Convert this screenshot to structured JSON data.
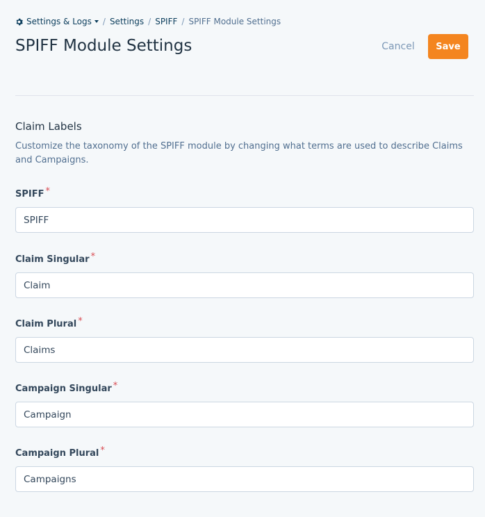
{
  "breadcrumb": {
    "root_label": "Settings & Logs",
    "separator": "/",
    "items": [
      "Settings",
      "SPIFF"
    ],
    "current": "SPIFF Module Settings"
  },
  "header": {
    "title": "SPIFF Module Settings",
    "cancel_label": "Cancel",
    "save_label": "Save"
  },
  "section": {
    "title": "Claim Labels",
    "description": "Customize the taxonomy of the SPIFF module by changing what terms are used to describe Claims and Campaigns."
  },
  "fields": [
    {
      "label": "SPIFF",
      "required_mark": "*",
      "value": "SPIFF"
    },
    {
      "label": "Claim Singular",
      "required_mark": "*",
      "value": "Claim"
    },
    {
      "label": "Claim Plural",
      "required_mark": "*",
      "value": "Claims"
    },
    {
      "label": "Campaign Singular",
      "required_mark": "*",
      "value": "Campaign"
    },
    {
      "label": "Campaign Plural",
      "required_mark": "*",
      "value": "Campaigns"
    }
  ],
  "colors": {
    "accent": "#f4851f",
    "required": "#d94c53",
    "background": "#f5f8fa"
  }
}
